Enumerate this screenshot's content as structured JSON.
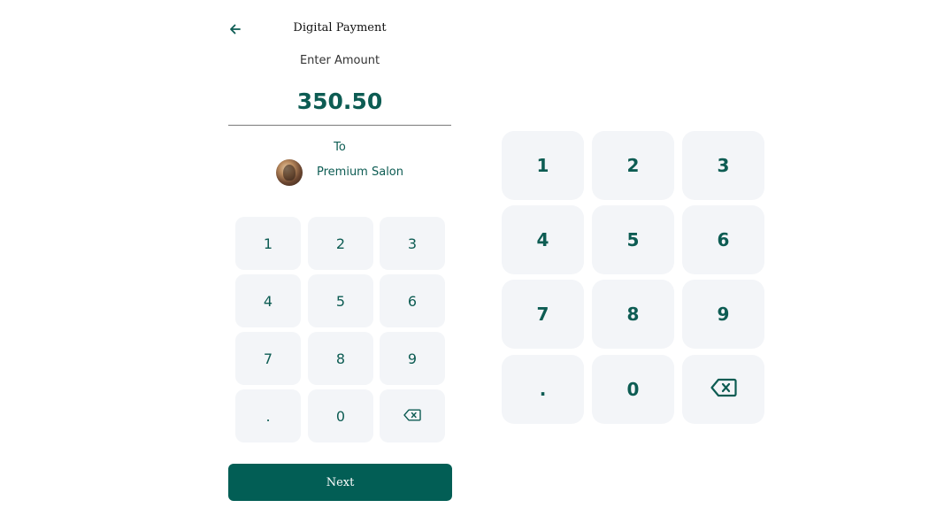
{
  "header": {
    "back_icon": "arrow-left-icon",
    "title": "Digital Payment"
  },
  "amount": {
    "label": "Enter Amount",
    "value": "350.50"
  },
  "recipient": {
    "to_label": "To",
    "name": "Premium Salon",
    "avatar": "salon-avatar"
  },
  "keypad_small": {
    "keys": [
      "1",
      "2",
      "3",
      "4",
      "5",
      "6",
      "7",
      "8",
      "9",
      ".",
      "0",
      "backspace-icon"
    ]
  },
  "keypad_large": {
    "keys": [
      "1",
      "2",
      "3",
      "4",
      "5",
      "6",
      "7",
      "8",
      "9",
      ".",
      "0",
      "backspace-icon"
    ]
  },
  "actions": {
    "next_label": "Next"
  },
  "colors": {
    "accent": "#025e55",
    "key_bg": "#f3f5f8",
    "text_accent": "#0d5c53"
  }
}
